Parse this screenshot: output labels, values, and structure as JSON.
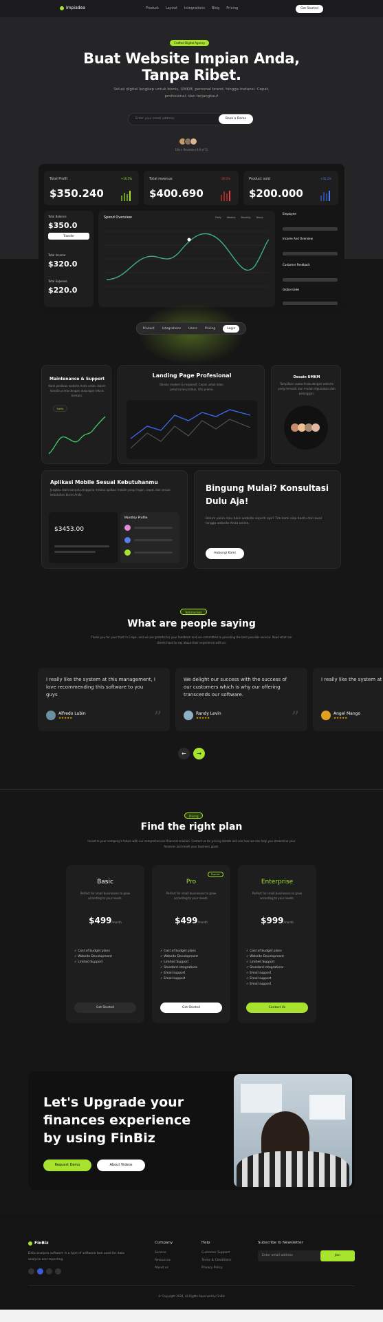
{
  "nav": {
    "brand": "Impiadea",
    "links": [
      "Product",
      "Layout",
      "Integrations",
      "Blog",
      "Pricing"
    ],
    "cta": "Get Started"
  },
  "hero": {
    "badge": "Crafted Digital Agency",
    "title_line1": "Buat Website Impian Anda,",
    "title_line2": "Tanpa Ribet.",
    "subtitle": "Solusi digital lengkap untuk bisnis, UMKM, personal brand, hingga instansi. Cepat, profesional, dan terjangkau!",
    "email_placeholder": "Enter your email address",
    "cta": "Book a Demo",
    "reviews": "10k+ Reviews (4.9 of 5)"
  },
  "dashboard": {
    "stats": [
      {
        "label": "Total Profit",
        "value": "$350.240",
        "delta": "+10.5%"
      },
      {
        "label": "Total revenue",
        "value": "$400.690",
        "delta": "-20.5%"
      },
      {
        "label": "Product sold",
        "value": "$200.000",
        "delta": "+32.1%"
      }
    ],
    "balance_label": "Total Balance",
    "balance_value": "$350.0",
    "transfer": "Transfer",
    "income_label": "Total Income",
    "income_value": "$320.0",
    "expense_label": "Total Expense",
    "expense_value": "$220.0",
    "chart_title": "Spend Overview",
    "chart_filters": [
      "Daily",
      "Weekly",
      "Monthly",
      "Yearly"
    ],
    "right_items": [
      "Employee",
      "Income And Overview",
      "Customer Feedback",
      "Global sales"
    ]
  },
  "tabs": [
    "Product",
    "Integrations",
    "Users",
    "Pricing",
    "Login"
  ],
  "services": {
    "maintenance": {
      "title": "Maintenance & Support",
      "desc": "Kami pastikan website Anda selalu dalam kondisi prima dengan dukungan teknis berkala.",
      "badge": "Traffic"
    },
    "landing": {
      "title": "Landing Page Profesional",
      "desc": "Desain modern & responsif. Cocok untuk iklan, peluncuran produk, dan promo."
    },
    "umkm": {
      "title": "Desain UMKM",
      "desc": "Tampilkan usaha Anda dengan website yang menarik dan mudah digunakan oleh pelanggan."
    },
    "mobile": {
      "title": "Aplikasi Mobile Sesuai Kebutuhanmu",
      "desc": "Jangkau lebih banyak pengguna melalui aplikasi mobile yang ringan, cepat, dan sesuai kebutuhan bisnis Anda.",
      "amount": "$3453.00",
      "monthly": "Monthly Profile"
    },
    "consult": {
      "title": "Bingung Mulai? Konsultasi Dulu Aja!",
      "desc": "Belum yakin mau bikin website seperti apa? Tim kami siap bantu dari awal hingga website Anda online.",
      "cta": "Hubungi Kami"
    }
  },
  "testimonials": {
    "badge": "Testimonials",
    "title": "What are people saying",
    "subtitle": "Thank you for your trust in Crepe, and we are grateful for your feedback and are committed to providing the best possible service. Read what our clients have to say about their experience with us.",
    "items": [
      {
        "quote": "I really like the system at this management, I love recommending this software to you guys",
        "name": "Alfredo Lubin",
        "stars": "★★★★★"
      },
      {
        "quote": "We delight our success with the success of our customers which is why our offering transcends our software.",
        "name": "Randy Levin",
        "stars": "★★★★★"
      },
      {
        "quote": "I really like the system at this management, I love recommending this software to you guys",
        "name": "Angel Mango",
        "stars": "★★★★★"
      }
    ]
  },
  "pricing": {
    "badge": "Pricing",
    "title": "Find the right plan",
    "subtitle": "Invest in your company's future with our comprehensive financial solution. Contact us for pricing details and see how we can help you streamline your finances and reach your business goals.",
    "plans": [
      {
        "name": "Basic",
        "desc": "Perfect for small businesses to grow according to your needs.",
        "price": "$499",
        "per": "/month",
        "features": [
          "Cost of budget plans",
          "Website Development",
          "Limited Support"
        ],
        "cta": "Get Started"
      },
      {
        "name": "Pro",
        "badge": "Popular",
        "desc": "Perfect for small businesses to grow according to your needs.",
        "price": "$499",
        "per": "/month",
        "features": [
          "Cost of budget plans",
          "Website Development",
          "Limited Support",
          "Standard integrations",
          "Email support",
          "Email support"
        ],
        "cta": "Get Started"
      },
      {
        "name": "Enterprise",
        "desc": "Perfect for small businesses to grow according to your needs.",
        "price": "$999",
        "per": "/month",
        "features": [
          "Cost of budget plans",
          "Website Development",
          "Limited Support",
          "Standard integrations",
          "Email support",
          "Email support",
          "Email support"
        ],
        "cta": "Contact Us"
      }
    ]
  },
  "upgrade": {
    "line1": "Let's Upgrade your",
    "line2": "finances experience",
    "line3": "by using FinBiz",
    "primary": "Request Demo",
    "secondary": "About Videos"
  },
  "footer": {
    "brand": "FinBiz",
    "desc": "Data analysis software is a type of software tool used for data analysis and reporting.",
    "cols": [
      {
        "title": "Company",
        "links": [
          "Service",
          "Resources",
          "About us"
        ]
      },
      {
        "title": "Help",
        "links": [
          "Customer Support",
          "Terms & Conditions",
          "Privacy Policy"
        ]
      }
    ],
    "newsletter_title": "Subscribe to Newsletter",
    "newsletter_placeholder": "Enter email address",
    "newsletter_cta": "Join",
    "copyright": "© Copyright 2024, All Rights Reserved by FinBiz"
  }
}
